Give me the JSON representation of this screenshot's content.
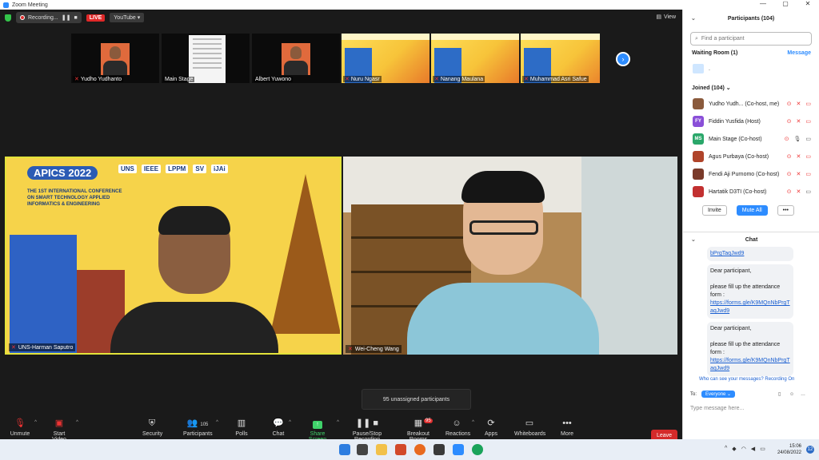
{
  "window": {
    "title": "Zoom Meeting"
  },
  "topbar": {
    "recording": "Recording...",
    "live": "LIVE",
    "youtube": "YouTube",
    "view": "View"
  },
  "strip": [
    {
      "name": "Yudho Yudhanto"
    },
    {
      "name": "Main Stage"
    },
    {
      "name": "Albert Yuwono"
    },
    {
      "name": "Nuru Ngasr"
    },
    {
      "name": "Nanang Maulana"
    },
    {
      "name": "Muhammad Asri Safue"
    }
  ],
  "videos": {
    "left": {
      "name": "UNS-Harman Saputro",
      "poster_title": "APICS 2022",
      "conf_lines": [
        "THE 1ST INTERNATIONAL CONFERENCE",
        "ON SMART TECHNOLOGY APPLIED",
        "INFORMATICS & ENGINEERING"
      ],
      "logos": [
        "UNS",
        "IEEE",
        "LPPM",
        "SV",
        "iJAi"
      ]
    },
    "right": {
      "name": "Wei-Cheng Wang"
    }
  },
  "unassigned": "95 unassigned participants",
  "toolbar": {
    "unmute": "Unmute",
    "start_video": "Start Video",
    "security": "Security",
    "participants": "Participants",
    "participants_count": "105",
    "polls": "Polls",
    "chat": "Chat",
    "share": "Share Screen",
    "record": "Pause/Stop Recording",
    "breakout": "Breakout Rooms",
    "breakout_badge": "95",
    "reactions": "Reactions",
    "apps": "Apps",
    "whiteboards": "Whiteboards",
    "more": "More",
    "leave": "Leave"
  },
  "panel": {
    "title": "Participants (104)",
    "search_placeholder": "Find a participant",
    "waiting_room": "Waiting Room (1)",
    "message": "Message",
    "waiting_name": ".",
    "joined": "Joined (104)",
    "participants": [
      {
        "name": "Yudho Yudh... (Co-host, me)",
        "initials": "",
        "color": "#8a5a3c"
      },
      {
        "name": "Fiddin Yusfida (Host)",
        "initials": "FY",
        "color": "#8a4fd8"
      },
      {
        "name": "Main Stage (Co-host)",
        "initials": "MS",
        "color": "#2aa76a"
      },
      {
        "name": "Agus Purbaya (Co-host)",
        "initials": "",
        "color": "#b0442a"
      },
      {
        "name": "Fendi Aji Purnomo (Co-host)",
        "initials": "",
        "color": "#7a3a2a"
      },
      {
        "name": "Hartatik D3TI (Co-host)",
        "initials": "",
        "color": "#c23030"
      }
    ],
    "invite": "Invite",
    "mute_all": "Mute All",
    "chat_title": "Chat",
    "chat_partial": "bPrgTaqJwd9",
    "messages": [
      {
        "greet": "Dear participant,",
        "body": "please fill up the attendance form :",
        "link": "https://forms.gle/K9MQnNbPrgTaqJwd9"
      },
      {
        "greet": "Dear participant,",
        "body": "please fill up the attendance form :",
        "link": "https://forms.gle/K9MQnNbPrgTaqJwd9"
      }
    ],
    "who_can_see": "Who can see your messages? Recording On",
    "to": "To:",
    "everyone": "Everyone",
    "msg_placeholder": "Type message here..."
  },
  "taskbar": {
    "time": "15:06",
    "date": "24/08/2022",
    "notif": "12"
  }
}
